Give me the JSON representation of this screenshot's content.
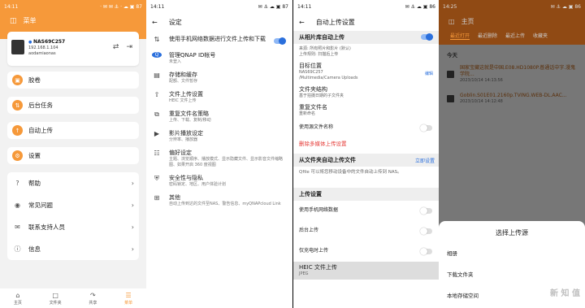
{
  "p1": {
    "time": "14:11",
    "status": "· ✉ ✉ ⚓ · ☁ ▣ 87",
    "title": "菜单",
    "device": {
      "name": "NAS69C257",
      "ip": "192.168.1.104",
      "user": "aodamiaonas"
    },
    "menu": [
      "胶卷",
      "后台任务",
      "自动上传",
      "设置"
    ],
    "group": [
      "帮助",
      "常见问题",
      "联系支持人员",
      "信息"
    ],
    "nav": [
      "主页",
      "文件夹",
      "共享",
      "菜单"
    ]
  },
  "p2": {
    "time": "14:11",
    "status": "✉ ⚓ ☁ ▣ 87",
    "title": "设定",
    "rows": [
      {
        "t": "使用手机网络数据进行文件上传和下载",
        "s": ""
      },
      {
        "t": "管理QNAP ID帐号",
        "s": "未登入"
      },
      {
        "t": "存储和缓存",
        "s": "配额、文件暂存"
      },
      {
        "t": "文件上传设置",
        "s": "HEIC 文件上传"
      },
      {
        "t": "重复文件名策略",
        "s": "上传、下载、复制/移动"
      },
      {
        "t": "影片播放设定",
        "s": "分辨率、播放器"
      },
      {
        "t": "偏好设定",
        "s": "主题、浏览顺序、播放模式、显示隐藏文件、显示影音文件缩略图、如果开启 360 度视图"
      },
      {
        "t": "安全性与隐私",
        "s": "密码锁定、地区、用户体验计划"
      },
      {
        "t": "其他",
        "s": "自动上传到达的文件至NAS、警告信息、myQNAPcloud Link"
      }
    ]
  },
  "p3": {
    "time": "14:11",
    "status": "✉ ⚓ ☁ ▣ 86",
    "title": "自动上传设置",
    "sec1": "从相片库自动上传",
    "src": "来源: 所有照片和影片 (默认)",
    "mode": "上传规则: 扫描后上传",
    "target": "目标位置",
    "target_dev": "NAS69C257",
    "target_path": "/Multimedia/Camera Uploads",
    "edit": "编辑",
    "struct": "文件夹结构",
    "struct_s": "基于拍摄日期的子文件夹",
    "dup": "重复文件名",
    "dup_s": "重新命名",
    "orig": "使用源文件名称",
    "delete": "删除多媒体上传设置",
    "sec2": "从文件夹自动上传文件",
    "setup": "立即设置",
    "folder_desc": "Qfile 可以将您移动设备中的文件自动上传到 NAS。",
    "sec3": "上传设置",
    "mobile": "使用手机网络数据",
    "bg": "后台上传",
    "charge": "仅充电时上传",
    "heic": "HEIC 文件上传",
    "heic_s": "JPEG"
  },
  "p4": {
    "time": "14:25",
    "status": "✉ ⚓ ☁ ▣ 86",
    "title": "主页",
    "tabs": [
      "最近打开",
      "最近删除",
      "最近上传",
      "收藏夹"
    ],
    "today": "今天",
    "files": [
      {
        "n": "国家宝藏这就是中国.E08.HD1080P.普通话中字.漫鬼学院...",
        "d": "2023/10/14 14:13:56"
      },
      {
        "n": "Goblin.S01E01.2160p.TVING.WEB-DL.AAC...",
        "d": "2023/10/14 14:12:48"
      }
    ],
    "sheet_title": "选择上传源",
    "options": [
      "相册",
      "下载文件夹",
      "本地存储空间"
    ],
    "watermark": "新 知 值"
  },
  "colors": {
    "accent": "#f6993a",
    "toggle_on": "#2a6fdc",
    "link": "#2a6fdc",
    "delete": "#e53935"
  }
}
